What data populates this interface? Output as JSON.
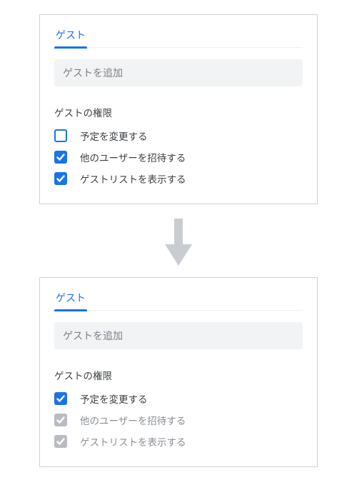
{
  "tab_label": "ゲスト",
  "input_placeholder": "ゲストを追加",
  "permissions_heading": "ゲストの権限",
  "before": {
    "permissions": [
      {
        "label": "予定を変更する",
        "checked": false,
        "disabled": false
      },
      {
        "label": "他のユーザーを招待する",
        "checked": true,
        "disabled": false
      },
      {
        "label": "ゲストリストを表示する",
        "checked": true,
        "disabled": false
      }
    ]
  },
  "after": {
    "permissions": [
      {
        "label": "予定を変更する",
        "checked": true,
        "disabled": false
      },
      {
        "label": "他のユーザーを招待する",
        "checked": true,
        "disabled": true
      },
      {
        "label": "ゲストリストを表示する",
        "checked": true,
        "disabled": true
      }
    ]
  },
  "colors": {
    "accent": "#1a73e8",
    "disabled": "#b8bcc1",
    "input_bg": "#f1f3f4"
  }
}
